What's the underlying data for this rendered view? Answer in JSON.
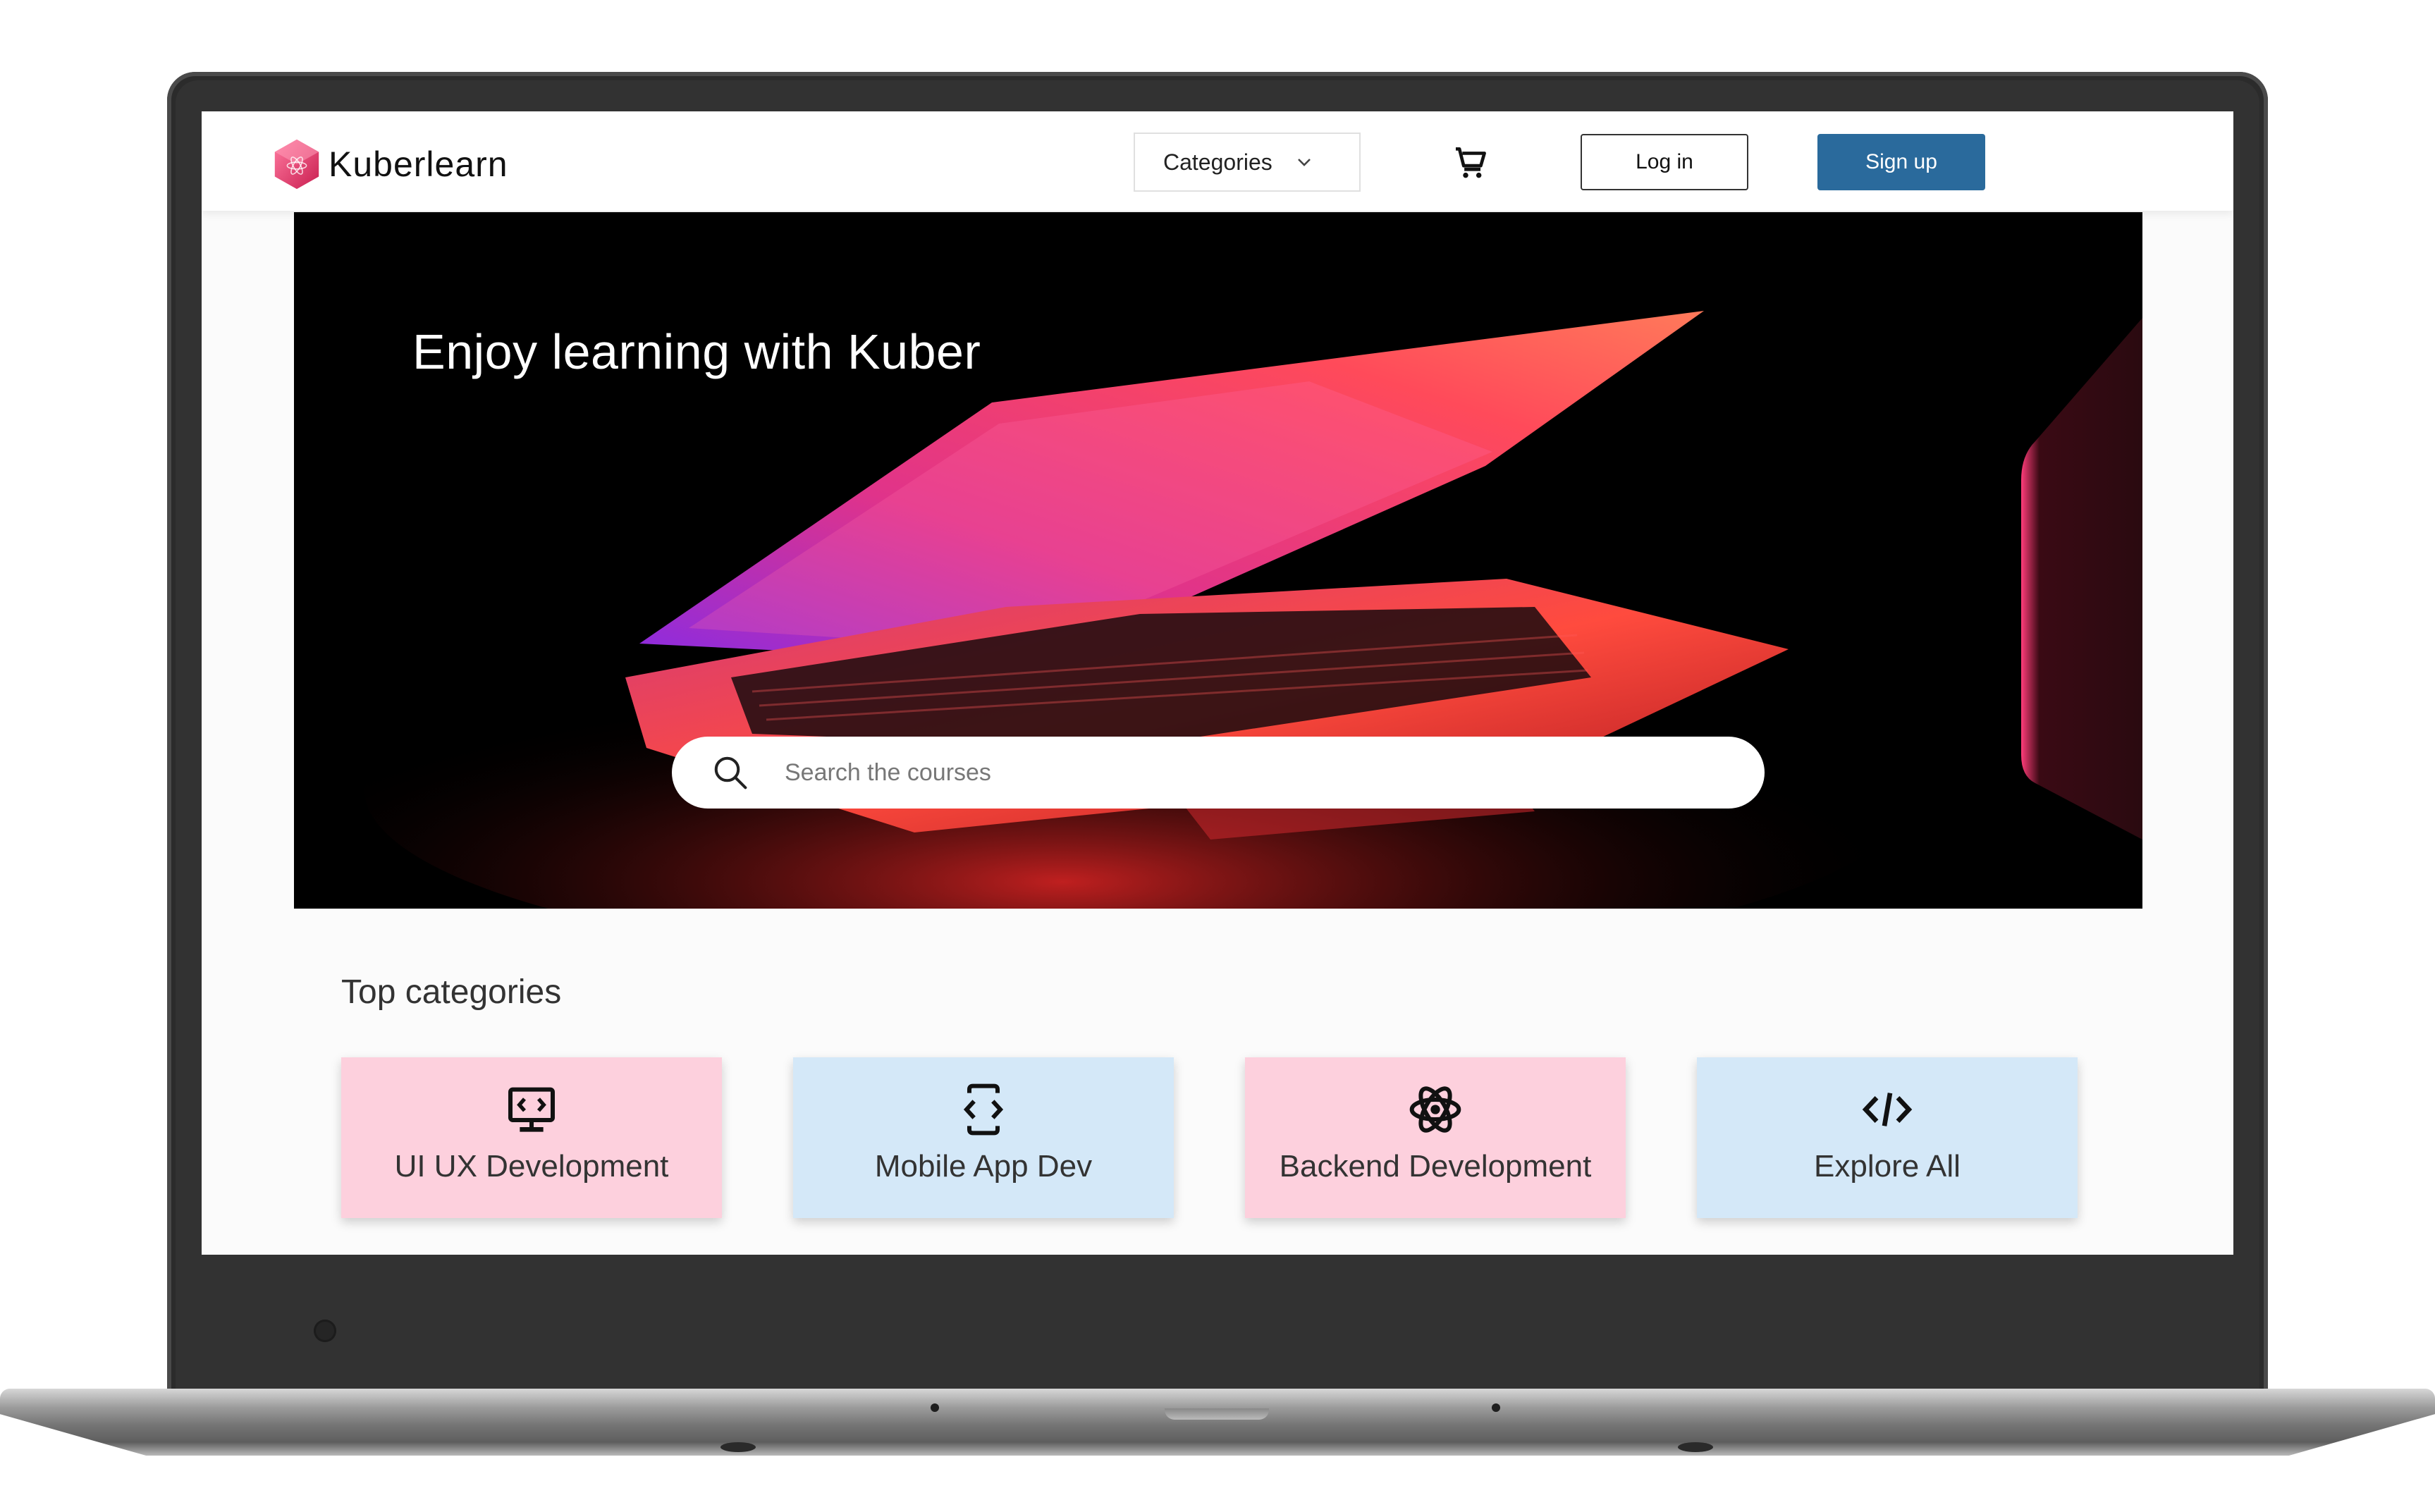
{
  "brand": {
    "name": "Kuberlearn",
    "logo_icon": "hexagon-atom-logo",
    "accent": "#e8406b"
  },
  "nav": {
    "categories_label": "Categories",
    "categories_icon": "chevron-down-icon",
    "cart_icon": "cart-icon",
    "login_label": "Log in",
    "signup_label": "Sign up",
    "signup_color": "#2a6a9c"
  },
  "hero": {
    "title": "Enjoy learning with Kuber",
    "search_placeholder": "Search the courses",
    "search_value": "",
    "search_icon": "search-icon"
  },
  "top_categories": {
    "title": "Top categories",
    "items": [
      {
        "label": "UI UX Development",
        "icon": "monitor-code-icon",
        "color": "#fdd0dd"
      },
      {
        "label": "Mobile App Dev",
        "icon": "mobile-code-icon",
        "color": "#d4e8f8"
      },
      {
        "label": "Backend Development",
        "icon": "atom-icon",
        "color": "#fdd0dd"
      },
      {
        "label": "Explore All",
        "icon": "code-brackets-icon",
        "color": "#d4e8f8"
      }
    ]
  }
}
